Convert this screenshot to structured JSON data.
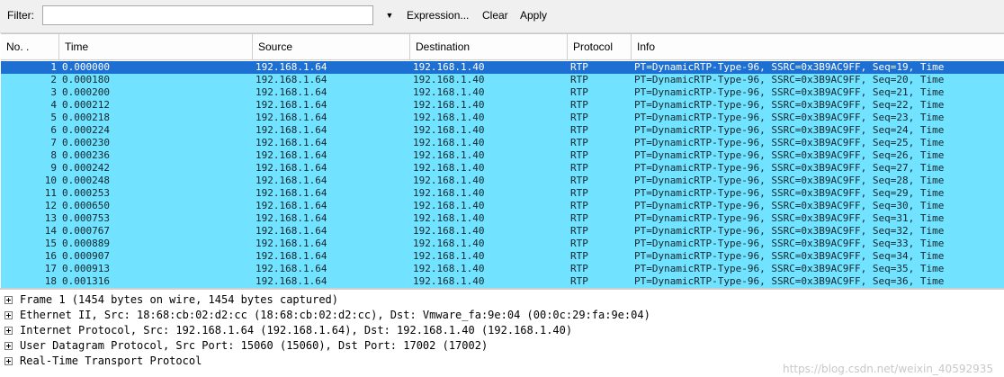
{
  "filter_bar": {
    "label": "Filter:",
    "value": "",
    "expression_label": "Expression...",
    "clear_label": "Clear",
    "apply_label": "Apply"
  },
  "columns": {
    "no": "No. .",
    "time": "Time",
    "source": "Source",
    "destination": "Destination",
    "protocol": "Protocol",
    "info": "Info"
  },
  "packets": [
    {
      "no": "1",
      "time": "0.000000",
      "source": "192.168.1.64",
      "destination": "192.168.1.40",
      "protocol": "RTP",
      "info": "PT=DynamicRTP-Type-96, SSRC=0x3B9AC9FF, Seq=19, Time"
    },
    {
      "no": "2",
      "time": "0.000180",
      "source": "192.168.1.64",
      "destination": "192.168.1.40",
      "protocol": "RTP",
      "info": "PT=DynamicRTP-Type-96, SSRC=0x3B9AC9FF, Seq=20, Time"
    },
    {
      "no": "3",
      "time": "0.000200",
      "source": "192.168.1.64",
      "destination": "192.168.1.40",
      "protocol": "RTP",
      "info": "PT=DynamicRTP-Type-96, SSRC=0x3B9AC9FF, Seq=21, Time"
    },
    {
      "no": "4",
      "time": "0.000212",
      "source": "192.168.1.64",
      "destination": "192.168.1.40",
      "protocol": "RTP",
      "info": "PT=DynamicRTP-Type-96, SSRC=0x3B9AC9FF, Seq=22, Time"
    },
    {
      "no": "5",
      "time": "0.000218",
      "source": "192.168.1.64",
      "destination": "192.168.1.40",
      "protocol": "RTP",
      "info": "PT=DynamicRTP-Type-96, SSRC=0x3B9AC9FF, Seq=23, Time"
    },
    {
      "no": "6",
      "time": "0.000224",
      "source": "192.168.1.64",
      "destination": "192.168.1.40",
      "protocol": "RTP",
      "info": "PT=DynamicRTP-Type-96, SSRC=0x3B9AC9FF, Seq=24, Time"
    },
    {
      "no": "7",
      "time": "0.000230",
      "source": "192.168.1.64",
      "destination": "192.168.1.40",
      "protocol": "RTP",
      "info": "PT=DynamicRTP-Type-96, SSRC=0x3B9AC9FF, Seq=25, Time"
    },
    {
      "no": "8",
      "time": "0.000236",
      "source": "192.168.1.64",
      "destination": "192.168.1.40",
      "protocol": "RTP",
      "info": "PT=DynamicRTP-Type-96, SSRC=0x3B9AC9FF, Seq=26, Time"
    },
    {
      "no": "9",
      "time": "0.000242",
      "source": "192.168.1.64",
      "destination": "192.168.1.40",
      "protocol": "RTP",
      "info": "PT=DynamicRTP-Type-96, SSRC=0x3B9AC9FF, Seq=27, Time"
    },
    {
      "no": "10",
      "time": "0.000248",
      "source": "192.168.1.64",
      "destination": "192.168.1.40",
      "protocol": "RTP",
      "info": "PT=DynamicRTP-Type-96, SSRC=0x3B9AC9FF, Seq=28, Time"
    },
    {
      "no": "11",
      "time": "0.000253",
      "source": "192.168.1.64",
      "destination": "192.168.1.40",
      "protocol": "RTP",
      "info": "PT=DynamicRTP-Type-96, SSRC=0x3B9AC9FF, Seq=29, Time"
    },
    {
      "no": "12",
      "time": "0.000650",
      "source": "192.168.1.64",
      "destination": "192.168.1.40",
      "protocol": "RTP",
      "info": "PT=DynamicRTP-Type-96, SSRC=0x3B9AC9FF, Seq=30, Time"
    },
    {
      "no": "13",
      "time": "0.000753",
      "source": "192.168.1.64",
      "destination": "192.168.1.40",
      "protocol": "RTP",
      "info": "PT=DynamicRTP-Type-96, SSRC=0x3B9AC9FF, Seq=31, Time"
    },
    {
      "no": "14",
      "time": "0.000767",
      "source": "192.168.1.64",
      "destination": "192.168.1.40",
      "protocol": "RTP",
      "info": "PT=DynamicRTP-Type-96, SSRC=0x3B9AC9FF, Seq=32, Time"
    },
    {
      "no": "15",
      "time": "0.000889",
      "source": "192.168.1.64",
      "destination": "192.168.1.40",
      "protocol": "RTP",
      "info": "PT=DynamicRTP-Type-96, SSRC=0x3B9AC9FF, Seq=33, Time"
    },
    {
      "no": "16",
      "time": "0.000907",
      "source": "192.168.1.64",
      "destination": "192.168.1.40",
      "protocol": "RTP",
      "info": "PT=DynamicRTP-Type-96, SSRC=0x3B9AC9FF, Seq=34, Time"
    },
    {
      "no": "17",
      "time": "0.000913",
      "source": "192.168.1.64",
      "destination": "192.168.1.40",
      "protocol": "RTP",
      "info": "PT=DynamicRTP-Type-96, SSRC=0x3B9AC9FF, Seq=35, Time"
    },
    {
      "no": "18",
      "time": "0.001316",
      "source": "192.168.1.64",
      "destination": "192.168.1.40",
      "protocol": "RTP",
      "info": "PT=DynamicRTP-Type-96, SSRC=0x3B9AC9FF, Seq=36, Time"
    }
  ],
  "details": [
    "Frame 1 (1454 bytes on wire, 1454 bytes captured)",
    "Ethernet II, Src: 18:68:cb:02:d2:cc (18:68:cb:02:d2:cc), Dst: Vmware_fa:9e:04 (00:0c:29:fa:9e:04)",
    "Internet Protocol, Src: 192.168.1.64 (192.168.1.64), Dst: 192.168.1.40 (192.168.1.40)",
    "User Datagram Protocol, Src Port: 15060 (15060), Dst Port: 17002 (17002)",
    "Real-Time Transport Protocol"
  ],
  "watermark": "https://blog.csdn.net/weixin_40592935",
  "colors": {
    "row_background": "#71e2ff",
    "selected_row_background": "#1e6fd2"
  },
  "icons": {
    "filter_dropdown": "chevron-down-icon",
    "tree_expand": "plus-box-icon"
  }
}
